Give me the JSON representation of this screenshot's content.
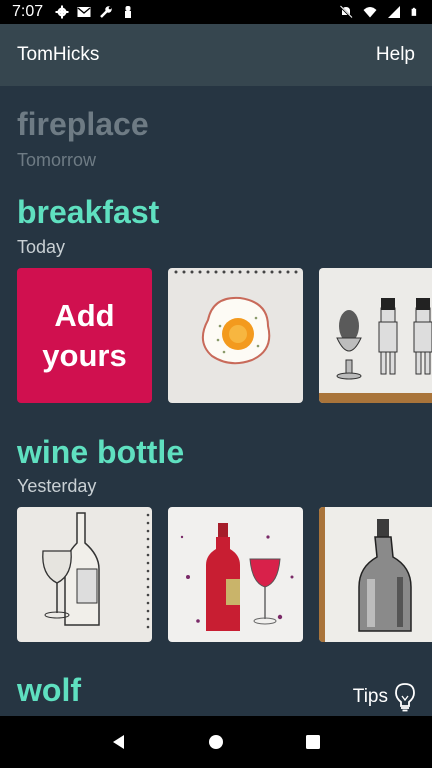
{
  "status_bar": {
    "time": "7:07",
    "icons_left": [
      "gear-icon",
      "mail-icon",
      "wrench-icon",
      "notification-icon"
    ],
    "icons_right": [
      "mute-icon",
      "wifi-icon",
      "signal-icon",
      "battery-icon"
    ]
  },
  "app_bar": {
    "user": "TomHicks",
    "help": "Help"
  },
  "sections": [
    {
      "title": "fireplace",
      "subtitle": "Tomorrow",
      "state": "upcoming"
    },
    {
      "title": "breakfast",
      "subtitle": "Today",
      "add_label_line1": "Add",
      "add_label_line2": "yours",
      "images": [
        "fried-egg-drawing",
        "egg-cup-and-soldiers-drawing"
      ]
    },
    {
      "title": "wine bottle",
      "subtitle": "Yesterday",
      "images": [
        "wine-bottle-and-glass-sketch",
        "red-wine-bottle-painting",
        "bottle-pencil-drawing"
      ]
    },
    {
      "title": "wolf"
    }
  ],
  "tips": {
    "label": "Tips",
    "icon": "lightbulb-icon"
  },
  "nav_bar": {
    "buttons": [
      "back-icon",
      "home-icon",
      "recents-icon"
    ]
  },
  "colors": {
    "background": "#263542",
    "app_bar": "#36464f",
    "accent_title": "#5fe0c0",
    "add_card": "#d0104f",
    "muted": "#6e7b84"
  }
}
